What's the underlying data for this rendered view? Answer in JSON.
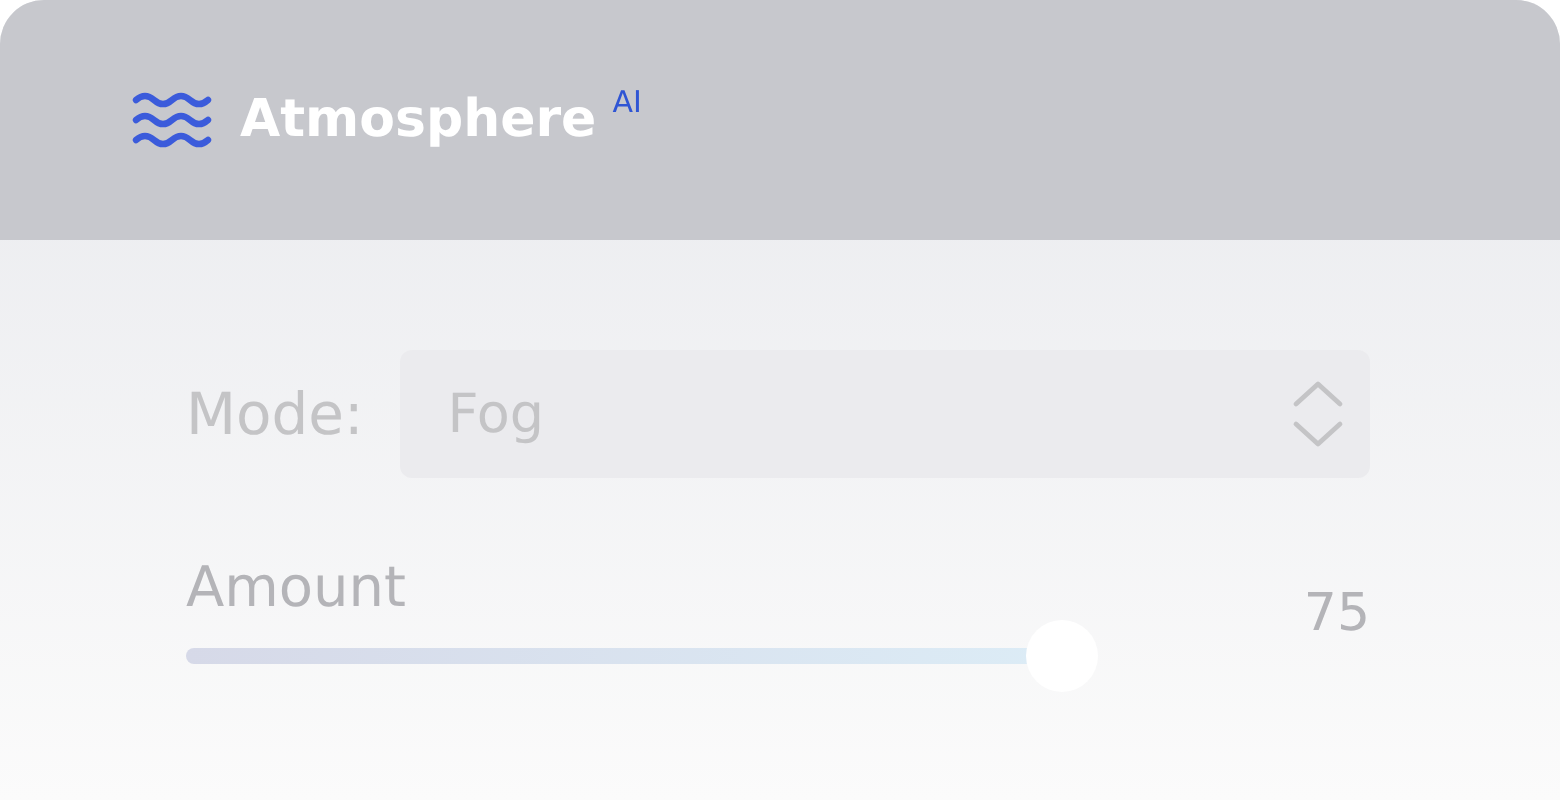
{
  "header": {
    "title": "Atmosphere",
    "badge": "AI"
  },
  "mode": {
    "label": "Mode:",
    "value": "Fog"
  },
  "amount": {
    "label": "Amount",
    "reading": "75",
    "level": 0.74
  }
}
